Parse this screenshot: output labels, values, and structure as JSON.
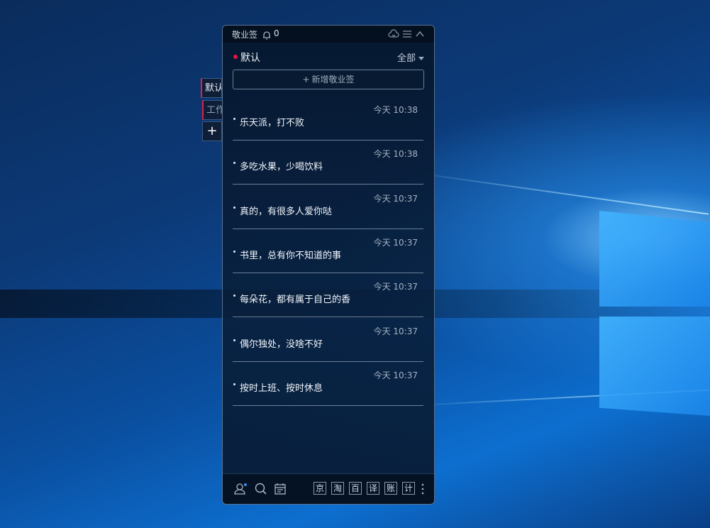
{
  "side_tabs": [
    {
      "label": "默认"
    },
    {
      "label": "工作"
    }
  ],
  "side_add_label": "+",
  "app": {
    "title": "敬业签",
    "notification_count": "0"
  },
  "category": {
    "name": "默认",
    "filter": "全部",
    "dot_color": "#e5163f"
  },
  "add_note_label": "新增敬业签",
  "notes": [
    {
      "time": "今天 10:38",
      "text": "乐天派，打不败"
    },
    {
      "time": "今天 10:38",
      "text": "多吃水果，少喝饮料"
    },
    {
      "time": "今天 10:37",
      "text": "真的，有很多人爱你哒"
    },
    {
      "time": "今天 10:37",
      "text": "书里，总有你不知道的事"
    },
    {
      "time": "今天 10:37",
      "text": "每朵花，都有属于自己的香"
    },
    {
      "time": "今天 10:37",
      "text": "偶尔独处，没啥不好"
    },
    {
      "time": "今天 10:37",
      "text": "按时上班、按时休息"
    }
  ],
  "footer_shortcuts": [
    "京",
    "淘",
    "百",
    "译",
    "账",
    "计"
  ],
  "icons": {
    "titlebar": [
      "cloud-sync-icon",
      "menu-icon",
      "collapse-icon"
    ],
    "footer": [
      "user-icon",
      "search-icon",
      "calendar-icon",
      "more-icon"
    ]
  }
}
